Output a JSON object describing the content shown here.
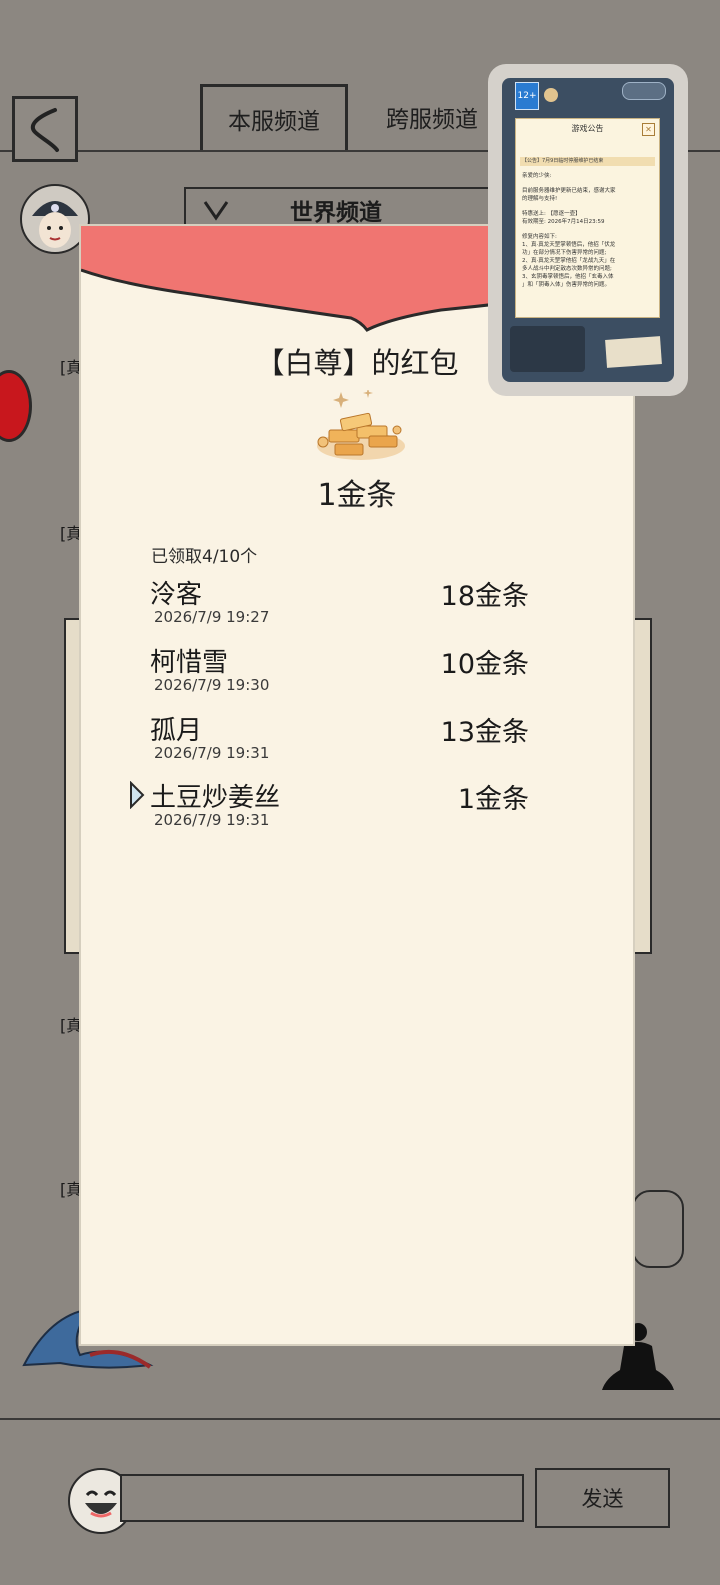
{
  "header": {
    "tabs": [
      {
        "label": "本服频道"
      },
      {
        "label": "跨服频道"
      }
    ]
  },
  "channel": {
    "selected": "世界频道"
  },
  "chat_tags": [
    "[真",
    "[真",
    "[真",
    "[真",
    "[真"
  ],
  "chat_input": {
    "placeholder": ""
  },
  "send_label": "发送",
  "red_packet": {
    "title": "【白尊】的红包",
    "amount": "1金条",
    "status": "已领取4/10个",
    "records": [
      {
        "name": "泠客",
        "time": "2026/7/9 19:27",
        "amount": "18金条"
      },
      {
        "name": "柯惜雪",
        "time": "2026/7/9 19:30",
        "amount": "10金条"
      },
      {
        "name": "孤月",
        "time": "2026/7/9 19:31",
        "amount": "13金条"
      },
      {
        "name": "土豆炒姜丝",
        "time": "2026/7/9 19:31",
        "amount": "1金条"
      }
    ],
    "colors": {
      "flap": "#f07571",
      "paper": "#faf3e4"
    }
  },
  "pip": {
    "rating": "12+",
    "dialog_title": "游戏公告",
    "banner": "【公告】7月9日临时停服维护已结束",
    "lines": [
      "亲爱的少侠:",
      "",
      "目前服务器维护更新已结束，感谢大家",
      "的理解与支持!",
      "",
      "特惠送上: 【愿逐一壶】",
      "有效期至: 2026年7月14日23:59",
      "",
      "修复内容如下:",
      "1、真·真龙天罡掌顿悟后，他招「伏龙",
      "功」在部分情况下伤害异常的问题;",
      "2、真·真龙天罡掌他招「龙战九天」在",
      "多人战斗中判定敌态次数异常的问题;",
      "3、玄阴毒掌顿悟后，他招「玄毒入体",
      "」和「阴毒入体」伤害异常的问题。"
    ]
  }
}
